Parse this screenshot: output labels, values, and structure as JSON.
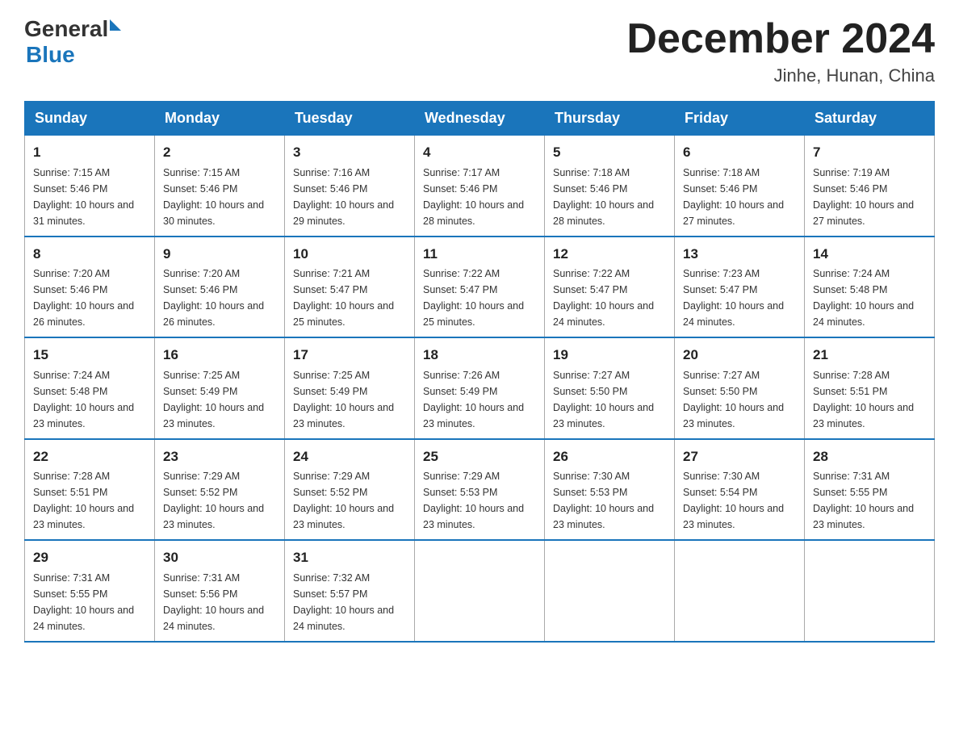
{
  "logo": {
    "general": "General",
    "blue": "Blue"
  },
  "header": {
    "title": "December 2024",
    "location": "Jinhe, Hunan, China"
  },
  "days_of_week": [
    "Sunday",
    "Monday",
    "Tuesday",
    "Wednesday",
    "Thursday",
    "Friday",
    "Saturday"
  ],
  "weeks": [
    [
      {
        "day": "1",
        "sunrise": "7:15 AM",
        "sunset": "5:46 PM",
        "daylight": "10 hours and 31 minutes."
      },
      {
        "day": "2",
        "sunrise": "7:15 AM",
        "sunset": "5:46 PM",
        "daylight": "10 hours and 30 minutes."
      },
      {
        "day": "3",
        "sunrise": "7:16 AM",
        "sunset": "5:46 PM",
        "daylight": "10 hours and 29 minutes."
      },
      {
        "day": "4",
        "sunrise": "7:17 AM",
        "sunset": "5:46 PM",
        "daylight": "10 hours and 28 minutes."
      },
      {
        "day": "5",
        "sunrise": "7:18 AM",
        "sunset": "5:46 PM",
        "daylight": "10 hours and 28 minutes."
      },
      {
        "day": "6",
        "sunrise": "7:18 AM",
        "sunset": "5:46 PM",
        "daylight": "10 hours and 27 minutes."
      },
      {
        "day": "7",
        "sunrise": "7:19 AM",
        "sunset": "5:46 PM",
        "daylight": "10 hours and 27 minutes."
      }
    ],
    [
      {
        "day": "8",
        "sunrise": "7:20 AM",
        "sunset": "5:46 PM",
        "daylight": "10 hours and 26 minutes."
      },
      {
        "day": "9",
        "sunrise": "7:20 AM",
        "sunset": "5:46 PM",
        "daylight": "10 hours and 26 minutes."
      },
      {
        "day": "10",
        "sunrise": "7:21 AM",
        "sunset": "5:47 PM",
        "daylight": "10 hours and 25 minutes."
      },
      {
        "day": "11",
        "sunrise": "7:22 AM",
        "sunset": "5:47 PM",
        "daylight": "10 hours and 25 minutes."
      },
      {
        "day": "12",
        "sunrise": "7:22 AM",
        "sunset": "5:47 PM",
        "daylight": "10 hours and 24 minutes."
      },
      {
        "day": "13",
        "sunrise": "7:23 AM",
        "sunset": "5:47 PM",
        "daylight": "10 hours and 24 minutes."
      },
      {
        "day": "14",
        "sunrise": "7:24 AM",
        "sunset": "5:48 PM",
        "daylight": "10 hours and 24 minutes."
      }
    ],
    [
      {
        "day": "15",
        "sunrise": "7:24 AM",
        "sunset": "5:48 PM",
        "daylight": "10 hours and 23 minutes."
      },
      {
        "day": "16",
        "sunrise": "7:25 AM",
        "sunset": "5:49 PM",
        "daylight": "10 hours and 23 minutes."
      },
      {
        "day": "17",
        "sunrise": "7:25 AM",
        "sunset": "5:49 PM",
        "daylight": "10 hours and 23 minutes."
      },
      {
        "day": "18",
        "sunrise": "7:26 AM",
        "sunset": "5:49 PM",
        "daylight": "10 hours and 23 minutes."
      },
      {
        "day": "19",
        "sunrise": "7:27 AM",
        "sunset": "5:50 PM",
        "daylight": "10 hours and 23 minutes."
      },
      {
        "day": "20",
        "sunrise": "7:27 AM",
        "sunset": "5:50 PM",
        "daylight": "10 hours and 23 minutes."
      },
      {
        "day": "21",
        "sunrise": "7:28 AM",
        "sunset": "5:51 PM",
        "daylight": "10 hours and 23 minutes."
      }
    ],
    [
      {
        "day": "22",
        "sunrise": "7:28 AM",
        "sunset": "5:51 PM",
        "daylight": "10 hours and 23 minutes."
      },
      {
        "day": "23",
        "sunrise": "7:29 AM",
        "sunset": "5:52 PM",
        "daylight": "10 hours and 23 minutes."
      },
      {
        "day": "24",
        "sunrise": "7:29 AM",
        "sunset": "5:52 PM",
        "daylight": "10 hours and 23 minutes."
      },
      {
        "day": "25",
        "sunrise": "7:29 AM",
        "sunset": "5:53 PM",
        "daylight": "10 hours and 23 minutes."
      },
      {
        "day": "26",
        "sunrise": "7:30 AM",
        "sunset": "5:53 PM",
        "daylight": "10 hours and 23 minutes."
      },
      {
        "day": "27",
        "sunrise": "7:30 AM",
        "sunset": "5:54 PM",
        "daylight": "10 hours and 23 minutes."
      },
      {
        "day": "28",
        "sunrise": "7:31 AM",
        "sunset": "5:55 PM",
        "daylight": "10 hours and 23 minutes."
      }
    ],
    [
      {
        "day": "29",
        "sunrise": "7:31 AM",
        "sunset": "5:55 PM",
        "daylight": "10 hours and 24 minutes."
      },
      {
        "day": "30",
        "sunrise": "7:31 AM",
        "sunset": "5:56 PM",
        "daylight": "10 hours and 24 minutes."
      },
      {
        "day": "31",
        "sunrise": "7:32 AM",
        "sunset": "5:57 PM",
        "daylight": "10 hours and 24 minutes."
      },
      null,
      null,
      null,
      null
    ]
  ],
  "labels": {
    "sunrise": "Sunrise:",
    "sunset": "Sunset:",
    "daylight": "Daylight:"
  }
}
